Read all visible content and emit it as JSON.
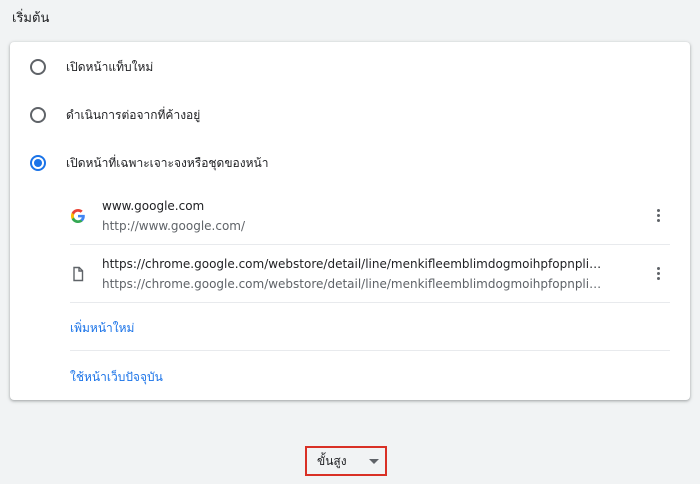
{
  "section": {
    "title": "เริ่มต้น"
  },
  "startup_options": [
    {
      "label": "เปิดหน้าแท็บใหม่",
      "checked": false
    },
    {
      "label": "ดำเนินการต่อจากที่ค้างอยู่",
      "checked": false
    },
    {
      "label": "เปิดหน้าที่เฉพาะเจาะจงหรือชุดของหน้า",
      "checked": true
    }
  ],
  "pages": [
    {
      "title": "www.google.com",
      "url": "http://www.google.com/",
      "icon": "google-g-icon"
    },
    {
      "title": "https://chrome.google.com/webstore/detail/line/menkifleemblimdogmoihpfopnplikd...",
      "url": "https://chrome.google.com/webstore/detail/line/menkifleemblimdogmoihpfopnplikd...",
      "icon": "page-icon"
    }
  ],
  "actions": {
    "add_page": "เพิ่มหน้าใหม่",
    "use_current": "ใช้หน้าเว็บปัจจุบัน"
  },
  "advanced": {
    "label": "ขั้นสูง"
  },
  "colors": {
    "accent": "#1a73e8",
    "highlight_border": "#d93025",
    "background": "#f1f3f4"
  }
}
